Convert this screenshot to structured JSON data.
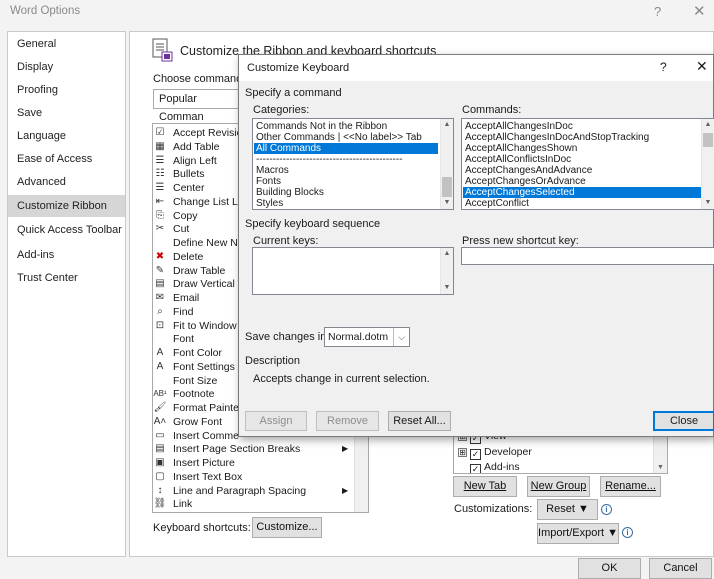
{
  "window": {
    "title": "Word Options",
    "help_glyph": "?",
    "close_glyph": "✕"
  },
  "nav": {
    "items": [
      {
        "label": "General"
      },
      {
        "label": "Display"
      },
      {
        "label": "Proofing"
      },
      {
        "label": "Save"
      },
      {
        "label": "Language"
      },
      {
        "label": "Ease of Access"
      },
      {
        "label": "Advanced"
      },
      {
        "label": "Customize Ribbon",
        "selected": true
      },
      {
        "label": "Quick Access Toolbar"
      },
      {
        "label": "Add-ins"
      },
      {
        "label": "Trust Center"
      }
    ]
  },
  "ribbon": {
    "heading": "Customize the Ribbon and keyboard shortcuts",
    "choose_label": "Choose commands",
    "choose_value": "Popular Comman",
    "commands": [
      {
        "icon": "accept-revision-icon",
        "glyph": "☑",
        "label": "Accept Revisio"
      },
      {
        "icon": "add-table-icon",
        "glyph": "▦",
        "label": "Add Table"
      },
      {
        "icon": "align-left-icon",
        "glyph": "☰",
        "label": "Align Left"
      },
      {
        "icon": "bullets-icon",
        "glyph": "☷",
        "label": "Bullets"
      },
      {
        "icon": "center-icon",
        "glyph": "☰",
        "label": "Center"
      },
      {
        "icon": "change-list-level-icon",
        "glyph": "⇤",
        "label": "Change List Le"
      },
      {
        "icon": "copy-icon",
        "glyph": "⎘",
        "label": "Copy"
      },
      {
        "icon": "cut-icon",
        "glyph": "✂",
        "label": "Cut"
      },
      {
        "icon": "",
        "glyph": "",
        "label": "Define New Nu"
      },
      {
        "icon": "delete-icon",
        "glyph": "✖",
        "label": "Delete"
      },
      {
        "icon": "draw-table-icon",
        "glyph": "✎",
        "label": "Draw Table"
      },
      {
        "icon": "draw-vertical-text-box-icon",
        "glyph": "▤",
        "label": "Draw Vertical T"
      },
      {
        "icon": "email-icon",
        "glyph": "✉",
        "label": "Email"
      },
      {
        "icon": "find-icon",
        "glyph": "⌕",
        "label": "Find"
      },
      {
        "icon": "fit-to-window-icon",
        "glyph": "⊡",
        "label": "Fit to Window"
      },
      {
        "icon": "",
        "glyph": "",
        "label": "Font"
      },
      {
        "icon": "font-color-icon",
        "glyph": "A",
        "label": "Font Color"
      },
      {
        "icon": "font-settings-icon",
        "glyph": "A",
        "label": "Font Settings"
      },
      {
        "icon": "",
        "glyph": "",
        "label": "Font Size"
      },
      {
        "icon": "footnote-icon",
        "glyph": "AB¹",
        "label": "Footnote"
      },
      {
        "icon": "format-painter-icon",
        "glyph": "🖌",
        "label": "Format Painter"
      },
      {
        "icon": "grow-font-icon",
        "glyph": "A˄",
        "label": "Grow Font"
      },
      {
        "icon": "insert-comment-icon",
        "glyph": "▭",
        "label": "Insert Comme"
      },
      {
        "icon": "insert-page-section-breaks-icon",
        "glyph": "▤",
        "label": "Insert Page  Section Breaks",
        "submenu": true
      },
      {
        "icon": "insert-picture-icon",
        "glyph": "▣",
        "label": "Insert Picture"
      },
      {
        "icon": "insert-text-box-icon",
        "glyph": "▢",
        "label": "Insert Text Box"
      },
      {
        "icon": "line-paragraph-spacing-icon",
        "glyph": "↕",
        "label": "Line and Paragraph Spacing",
        "submenu": true
      },
      {
        "icon": "link-icon",
        "glyph": "⛓",
        "label": "Link"
      }
    ],
    "submenu_arrow": "▶",
    "keyboard_shortcuts_label": "Keyboard shortcuts:",
    "customize_button": "Customize...",
    "tree": [
      {
        "label": "View",
        "checked": true,
        "expander": "⊞"
      },
      {
        "label": "Developer",
        "checked": true,
        "expander": "⊞"
      },
      {
        "label": "Add-ins",
        "checked": true,
        "expander": ""
      }
    ],
    "new_tab_button": "New Tab",
    "new_group_button": "New Group",
    "rename_button": "Rename...",
    "customizations_label": "Customizations:",
    "reset_button": "Reset ▼",
    "import_export_button": "Import/Export ▼",
    "info_glyph": "i"
  },
  "dialog": {
    "title": "Customize Keyboard",
    "help_glyph": "?",
    "close_glyph": "✕",
    "specify_command": "Specify a command",
    "categories_label": "Categories:",
    "categories": [
      {
        "label": "Commands Not in the Ribbon"
      },
      {
        "label": "Other Commands | <<No label>> Tab"
      },
      {
        "label": "All Commands",
        "selected": true
      },
      {
        "label": "--------------------------------------------"
      },
      {
        "label": "Macros"
      },
      {
        "label": "Fonts"
      },
      {
        "label": "Building Blocks"
      },
      {
        "label": "Styles"
      }
    ],
    "commands_label": "Commands:",
    "commands": [
      {
        "label": "AcceptAllChangesInDoc"
      },
      {
        "label": "AcceptAllChangesInDocAndStopTracking"
      },
      {
        "label": "AcceptAllChangesShown"
      },
      {
        "label": "AcceptAllConflictsInDoc"
      },
      {
        "label": "AcceptChangesAndAdvance"
      },
      {
        "label": "AcceptChangesOrAdvance"
      },
      {
        "label": "AcceptChangesSelected",
        "selected": true
      },
      {
        "label": "AcceptConflict"
      }
    ],
    "keyboard_sequence": "Specify keyboard sequence",
    "current_keys_label": "Current keys:",
    "new_shortcut_label": "Press new shortcut key:",
    "new_shortcut_value": "",
    "save_changes_label": "Save changes in:",
    "save_changes_value": "Normal.dotm",
    "description_label": "Description",
    "description_text": "Accepts change in current selection.",
    "assign_button": "Assign",
    "remove_button": "Remove",
    "reset_all_button": "Reset All...",
    "close_button": "Close"
  },
  "footer": {
    "ok_button": "OK",
    "cancel_button": "Cancel"
  }
}
